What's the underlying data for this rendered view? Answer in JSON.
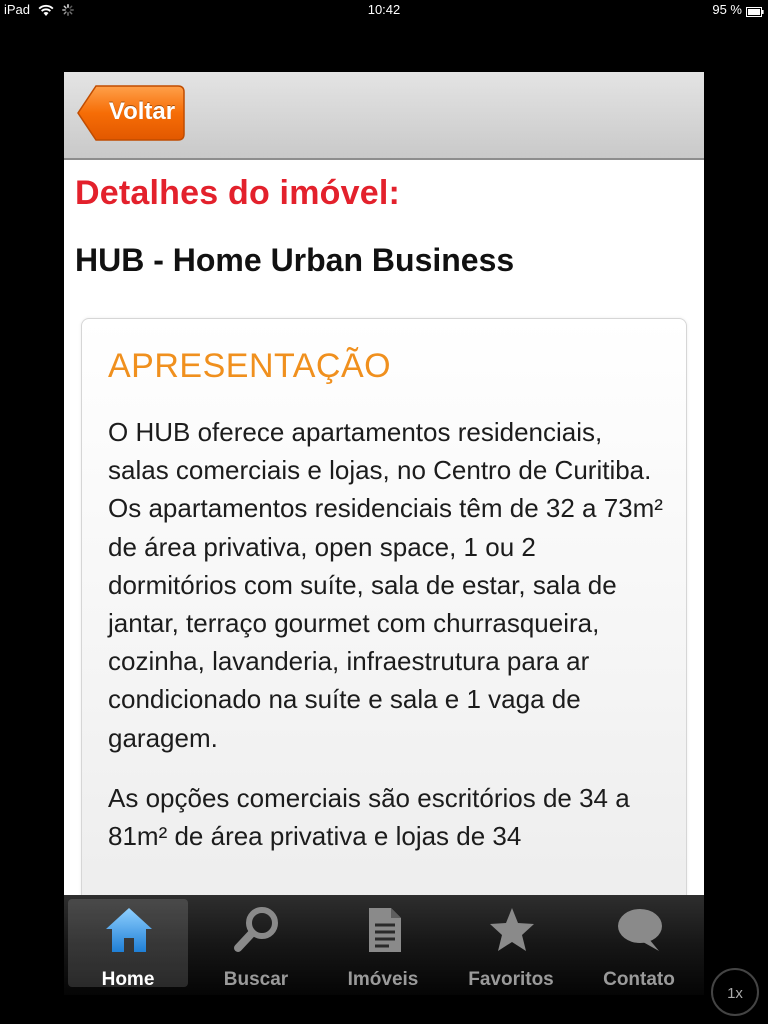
{
  "status_bar": {
    "device": "iPad",
    "time": "10:42",
    "battery": "95 %"
  },
  "header": {
    "back_label": "Voltar"
  },
  "content": {
    "heading": "Detalhes do imóvel:",
    "property_name": "HUB - Home Urban Business",
    "card": {
      "title": "APRESENTAÇÃO",
      "paragraphs": [
        "O HUB oferece apartamentos residenciais, salas comerciais e lojas, no Centro de Curitiba. Os apartamentos residenciais têm de 32 a 73m² de área privativa, open space, 1 ou 2 dormitórios com suíte, sala de estar, sala de jantar, terraço gourmet com churrasqueira, cozinha, lavanderia, infraestrutura para ar condicionado na suíte e sala e 1 vaga de garagem.",
        "As opções comerciais são escritórios de 34 a 81m² de área privativa e lojas de 34"
      ]
    }
  },
  "tabbar": {
    "tabs": [
      {
        "label": "Home",
        "icon": "home-icon",
        "active": true
      },
      {
        "label": "Buscar",
        "icon": "search-icon",
        "active": false
      },
      {
        "label": "Imóveis",
        "icon": "document-icon",
        "active": false
      },
      {
        "label": "Favoritos",
        "icon": "star-icon",
        "active": false
      },
      {
        "label": "Contato",
        "icon": "speech-bubble-icon",
        "active": false
      }
    ]
  },
  "zoom_badge": "1x",
  "colors": {
    "heading_red": "#e3212c",
    "card_title_orange": "#f0901e",
    "back_button_orange": "#f36f0a",
    "home_icon_blue": "#3d9fe6"
  }
}
